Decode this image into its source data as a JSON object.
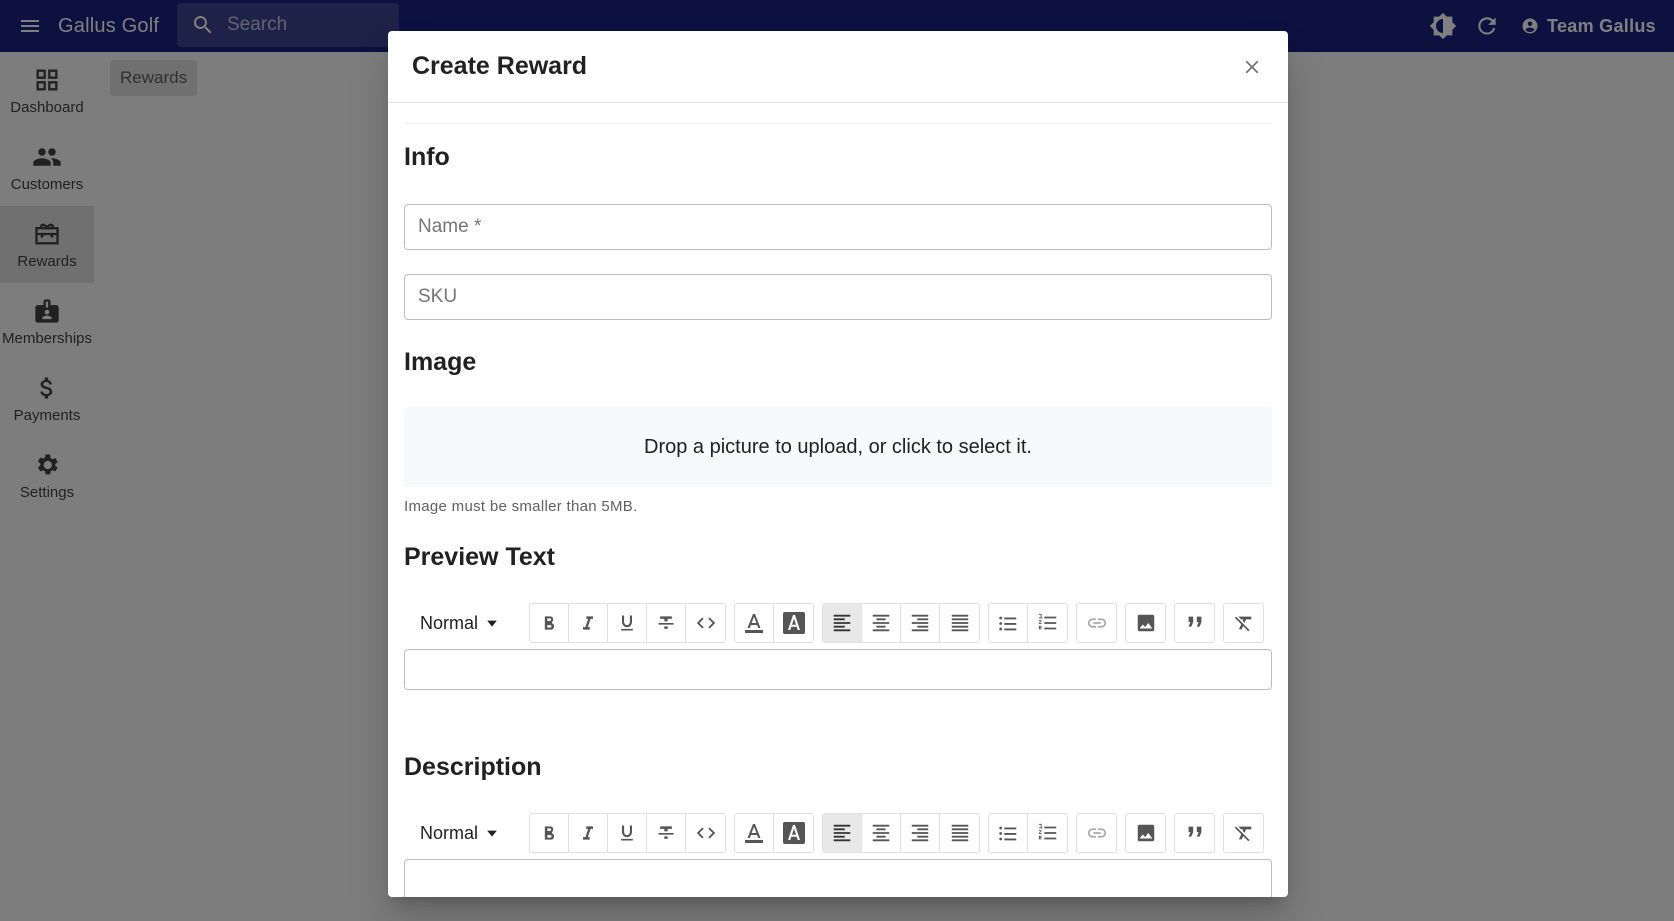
{
  "app": {
    "title": "Gallus Golf",
    "user": "Team Gallus"
  },
  "search": {
    "placeholder": "Search"
  },
  "sidebar": {
    "items": [
      {
        "label": "Dashboard",
        "icon": "dashboard-icon"
      },
      {
        "label": "Customers",
        "icon": "people-icon"
      },
      {
        "label": "Rewards",
        "icon": "card-giftcard-icon",
        "active": true
      },
      {
        "label": "Memberships",
        "icon": "badge-icon"
      },
      {
        "label": "Payments",
        "icon": "dollar-icon"
      },
      {
        "label": "Settings",
        "icon": "gear-icon"
      }
    ]
  },
  "breadcrumb": {
    "label": "Rewards"
  },
  "modal": {
    "title": "Create Reward",
    "info": {
      "title": "Info",
      "name_label": "Name *",
      "sku_label": "SKU"
    },
    "image": {
      "title": "Image",
      "drop_text": "Drop a picture to upload, or click to select it.",
      "helper": "Image must be smaller than 5MB."
    },
    "preview_text": {
      "title": "Preview Text",
      "format": "Normal"
    },
    "description": {
      "title": "Description",
      "format": "Normal"
    }
  }
}
